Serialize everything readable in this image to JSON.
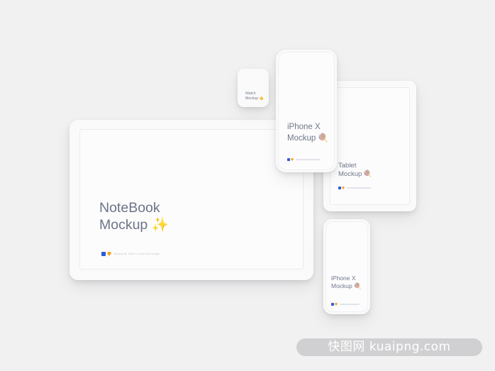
{
  "notebook": {
    "title_line1": "NoteBook",
    "title_line2": "Mockup",
    "emoji": "✨",
    "credit": "Mockup By Tianle Liu and Kara Design"
  },
  "watch": {
    "title_line1": "Watch",
    "title_line2": "Mockup",
    "emoji": "🤙"
  },
  "tablet": {
    "title_line1": "Tablet",
    "title_line2": "Mockup",
    "emoji": "🍭"
  },
  "iphone_large": {
    "title_line1": "iPhone X",
    "title_line2": "Mockup",
    "emoji": "🍭"
  },
  "iphone_small": {
    "title_line1": "iPhone X",
    "title_line2": "Mockup",
    "emoji": "🍭"
  },
  "icons": {
    "photoshop": "photoshop-icon",
    "sketch": "sketch-icon"
  },
  "colors": {
    "background": "#f1f1f2",
    "device": "#fafafb",
    "text": "#70788a",
    "photoshop_blue": "#2b5bd6",
    "sketch_orange": "#f5a623"
  },
  "watermark": "快图网 kuaipng.com"
}
